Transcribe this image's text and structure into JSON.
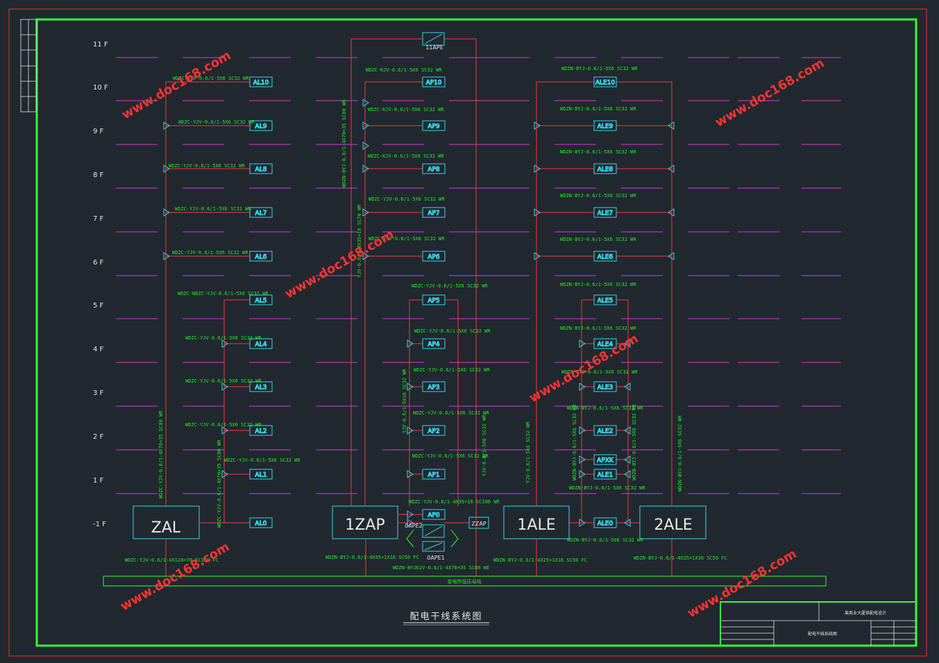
{
  "drawing": {
    "title": "配电干线系统图",
    "bus_label": "变电所低压母线",
    "title_block": {
      "project": "某商业大厦供配电设计",
      "sheet_name": "配电干线系统图"
    }
  },
  "floors": [
    "11 F",
    "10 F",
    "9 F",
    "8 F",
    "7 F",
    "6 F",
    "5 F",
    "4 F",
    "3 F",
    "2 F",
    "1 F",
    "-1 F"
  ],
  "main_panels": {
    "zal": "ZAL",
    "zap": "1ZAP",
    "ale1": "1ALE",
    "ale2": "2ALE"
  },
  "al": {
    "al10": {
      "name": "AL10",
      "cable": "WDZC-YJV-0.6/1-5X6 SC32 WR"
    },
    "al9": {
      "name": "AL9",
      "cable": "WDZC-YJV-0.6/1-5X6 SC32 WR"
    },
    "al8": {
      "name": "AL8",
      "cable": "WDZC-YJV-0.6/1-5X6 SC32 WR"
    },
    "al7": {
      "name": "AL7",
      "cable": "WDZC-YJV-0.6/1-5X6 SC32 WR"
    },
    "al6": {
      "name": "AL6",
      "cable": "WDZC-YJV-0.6/1-5X6 SC32 WR"
    },
    "al5": {
      "name": "AL5",
      "cable": "WDZC-WDZC-YJV-0.6/1-5X6 SC32 WR"
    },
    "al4": {
      "name": "AL4",
      "cable": "WDZC-YJV-0.6/1-5X6 SC32 WR"
    },
    "al3": {
      "name": "AL3",
      "cable": "WDZC-YJV-0.6/1-5X6 SC32 WR"
    },
    "al2": {
      "name": "AL2",
      "cable": "WDZC-YJV-0.6/1-5X6 SC32 WR"
    },
    "al1": {
      "name": "AL1",
      "cable": "WDZC-YJV-0.6/1-5X6 SC32 WR"
    },
    "al0": {
      "name": "AL0"
    },
    "riser1": "WDZC-YJV-0.6/1-4X70+35 SC80 WR",
    "riser2": "WDZC-YJV-0.6/1-4X70+35 SC80 WR",
    "feed": "WDZC-YJV-0.6/1-4X120+70 SC100 FC"
  },
  "ap": {
    "tape": "11APE",
    "ap10": {
      "name": "AP10",
      "cable": "WDZC-KJV-0.6/1-5X6 SC32 WR"
    },
    "ap9": {
      "name": "AP9",
      "cable": "WDZC-KJV-0.6/1-5X6 SC32 WR"
    },
    "ap8": {
      "name": "AP8",
      "cable": "WDZC-KJV-0.6/1-5X6 SC32 WR"
    },
    "ap7": {
      "name": "AP7",
      "cable": "WDZC-YJV-0.6/1-5X6 SC32 WR"
    },
    "ap6": {
      "name": "AP6",
      "cable": "WDZC-YJV-0.6/1-5X6 SC32 WR"
    },
    "ap5": {
      "name": "AP5",
      "cable": "WDZC-YJV-0.6/1-5X6 SC32 WR"
    },
    "ap4": {
      "name": "AP4",
      "cable": "WDZC-YJV-0.6/1-5X6 SC32 WR"
    },
    "ap3": {
      "name": "AP3",
      "cable": "WDZC-YJV-0.6/1-5X6 SC32 WR"
    },
    "ap2": {
      "name": "AP2",
      "cable": "WDZC-YJV-0.6/1-5X6 SC32 WR"
    },
    "ap1": {
      "name": "AP1",
      "cable": "WDZC-YJV-0.6/1-5X6 SC32 WR"
    },
    "ap0": {
      "name": "AP0",
      "cable": "WDZC-YJV-0.6/1-4X35+16 SC100 WR"
    },
    "zzap": "ZZAP",
    "oape2": "0APE2",
    "oape1": "0APE1",
    "riser_a": "WDZN-BYJ-0.6/1-4X70+35 SC80 WR",
    "riser_b": "YJV-0.6/1-4X35+16 SC70 WR",
    "riser_c": "YJV-0.6/1-5X16 SC32 WR",
    "riser_d": "YJV-0.6/1-5X6 SC32 WR",
    "feed": "WDZN-BYJ-0.6/1-4X35+1X16 SC50 FC",
    "feed2": "WDZN-BYJKJV-0.6/1-4X70+35 SC80 WE"
  },
  "ale": {
    "ale10": {
      "name": "ALE10",
      "cable": "WDZN-BYJ-0.6/1-5X6 SC32 WR"
    },
    "ale9": {
      "name": "ALE9",
      "cable": "WDZN-BYJ-0.6/1-5X6 SC32 WR"
    },
    "ale8": {
      "name": "ALE8",
      "cable": "WDZN-BYJ-0.6/1-5X6 SC32 WR"
    },
    "ale7": {
      "name": "ALE7",
      "cable": "WDZN-BYJ-0.6/1-5X6 SC32 WR"
    },
    "ale6": {
      "name": "ALE6",
      "cable": "WDZN-BYJ-0.6/1-5X6 SC32 WR"
    },
    "ale5": {
      "name": "ALE5",
      "cable": "WDZN-BYJ-0.6/1-5X6 SC32 WR"
    },
    "ale4": {
      "name": "ALE4",
      "cable": "WDZN-BYJ-0.6/1-5X6 SC32 WR"
    },
    "ale3": {
      "name": "ALE3",
      "cable": "WDZN-BYJ-0.6/1-5X6 SC32 WR"
    },
    "ale2": {
      "name": "ALE2",
      "cable": "WDZN-BYJ-0.6/1-5X6 SC32 WR"
    },
    "apxk": {
      "name": "APXK"
    },
    "ale1": {
      "name": "ALE1",
      "cable": "WDZN-BYJ-0.6/1-5X6 SC32 WR"
    },
    "ale0": {
      "name": "ALE0",
      "cable": "WDZN-BYJ-0.6/1-5X6 SC32 WR"
    },
    "riser_l": "YJV-0.6/1-5X6 SC32 WR",
    "riser_r": "WDZN-BYJ-0.6/1-5X6 SC32 WR",
    "riser_ml": "WDZN-BYJ-0.6/1-5X6 SC32 WR",
    "riser_mr": "WDZN-BYJ-0.6/1-5X6 SC32 WR",
    "feed1": "WDZN-BYJ-0.6/1-4X25+1X16 SC50 FC",
    "feed2": "WDZN-BYJ-0.6/1-4X35+1X16 SC50 FC"
  },
  "watermark": "www.doc168.com",
  "colors": {
    "frame_outer": "#ff2a2a",
    "frame_inner": "#33ff33",
    "floor_line": "#d838d8",
    "wire": "#ff3333",
    "box": "#36d6ea",
    "label": "#22ee22"
  }
}
